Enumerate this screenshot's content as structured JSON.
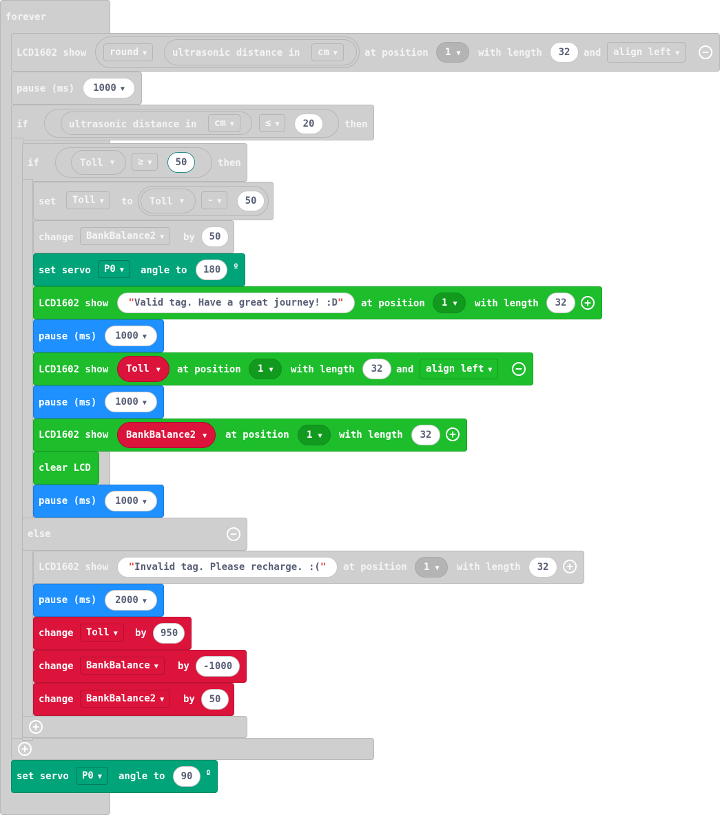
{
  "forever": "forever",
  "row1": {
    "lcd": "LCD1602 show",
    "round_dd": "round",
    "ultra": "ultrasonic distance in",
    "unit": "cm",
    "at_pos": "at position",
    "pos": "1",
    "with_len": "with length",
    "len": "32",
    "and": "and",
    "align": "align left"
  },
  "pause1": {
    "label": "pause (ms)",
    "value": "1000"
  },
  "if1": {
    "if": "if",
    "ultra": "ultrasonic distance in",
    "unit": "cm",
    "op": "≤",
    "value": "20",
    "then": "then"
  },
  "if2": {
    "if": "if",
    "var": "Toll",
    "op": "≥",
    "value": "50",
    "then": "then"
  },
  "set_toll": {
    "set": "set",
    "var": "Toll",
    "to": "to",
    "var2": "Toll",
    "op": "-",
    "value": "50"
  },
  "change_bb2": {
    "change": "change",
    "var": "BankBalance2",
    "by": "by",
    "value": "50"
  },
  "servo1": {
    "label": "set servo",
    "pin": "P0",
    "angle": "angle to",
    "value": "180",
    "deg": "º"
  },
  "lcd_valid": {
    "lcd": "LCD1602 show",
    "text": "Valid tag. Have a great journey! :D",
    "at_pos": "at position",
    "pos": "1",
    "with_len": "with length",
    "len": "32"
  },
  "pause2": {
    "label": "pause (ms)",
    "value": "1000"
  },
  "lcd_toll": {
    "lcd": "LCD1602 show",
    "var": "Toll",
    "at_pos": "at position",
    "pos": "1",
    "with_len": "with length",
    "len": "32",
    "and": "and",
    "align": "align left"
  },
  "pause3": {
    "label": "pause (ms)",
    "value": "1000"
  },
  "lcd_bb2": {
    "lcd": "LCD1602 show",
    "var": "BankBalance2",
    "at_pos": "at position",
    "pos": "1",
    "with_len": "with length",
    "len": "32"
  },
  "clear": "clear LCD",
  "pause4": {
    "label": "pause (ms)",
    "value": "1000"
  },
  "else": "else",
  "lcd_invalid": {
    "lcd": "LCD1602 show",
    "text": "Invalid tag. Please recharge. :(",
    "at_pos": "at position",
    "pos": "1",
    "with_len": "with length",
    "len": "32"
  },
  "pause5": {
    "label": "pause (ms)",
    "value": "2000"
  },
  "change_toll": {
    "change": "change",
    "var": "Toll",
    "by": "by",
    "value": "950"
  },
  "change_bb": {
    "change": "change",
    "var": "BankBalance",
    "by": "by",
    "value": "-1000"
  },
  "change_bb2b": {
    "change": "change",
    "var": "BankBalance2",
    "by": "by",
    "value": "50"
  },
  "servo2": {
    "label": "set servo",
    "pin": "P0",
    "angle": "angle to",
    "value": "90",
    "deg": "º"
  },
  "icons": {
    "dropdown": "caret-down-icon",
    "add": "plus-circle-icon",
    "remove": "minus-circle-icon"
  },
  "colors": {
    "disabled": "#cfcfcf",
    "servo": "#00a478",
    "lcd": "#1dbd2c",
    "pause": "#1e90ff",
    "variables": "#dc143c"
  }
}
